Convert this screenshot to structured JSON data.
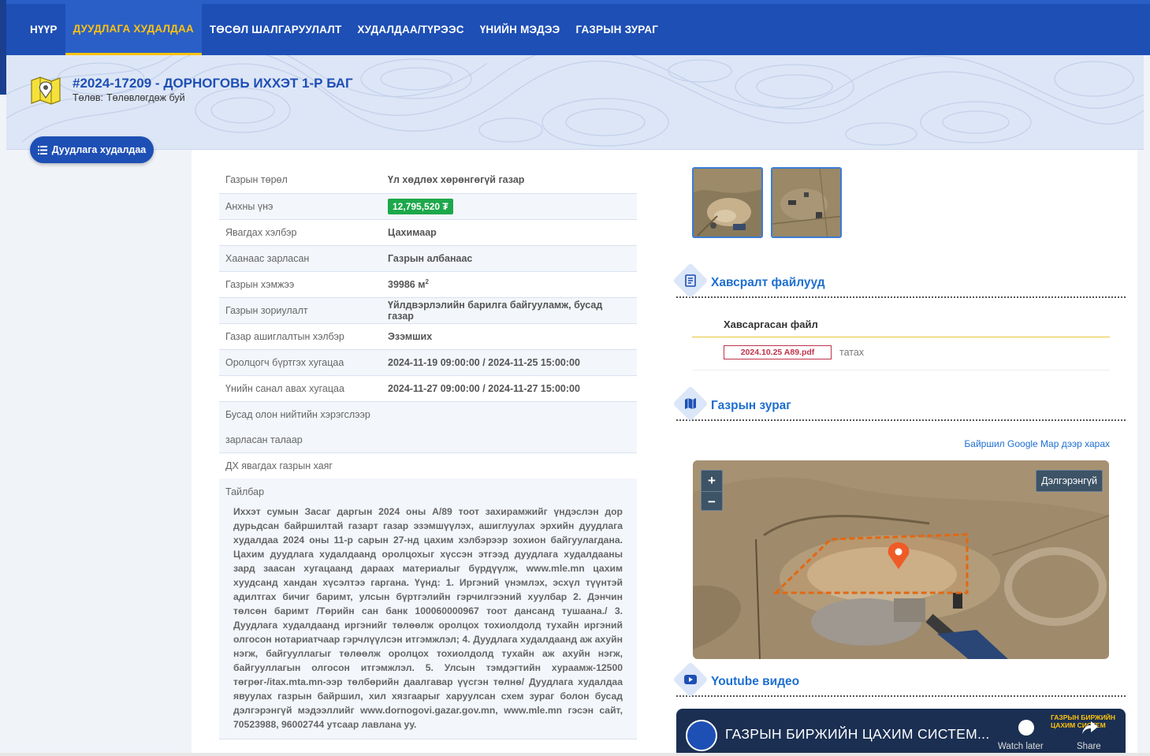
{
  "nav": {
    "items": [
      {
        "label": "НҮҮР",
        "active": false
      },
      {
        "label": "ДУУДЛАГА ХУДАЛДАА",
        "active": true
      },
      {
        "label": "ТӨСӨЛ ШАЛГАРУУЛАЛТ",
        "active": false
      },
      {
        "label": "ХУДАЛДАА/ТҮРЭЭС",
        "active": false
      },
      {
        "label": "ҮНИЙН МЭДЭЭ",
        "active": false
      },
      {
        "label": "ГАЗРЫН ЗУРАГ",
        "active": false
      }
    ]
  },
  "header": {
    "title": "#2024-17209 - ДОРНОГОВЬ ИХХЭТ 1-Р БАГ",
    "status_label": "Төлөв:",
    "status_value": "Төлөвлөгдөж буй"
  },
  "back_button": {
    "label": "Дуудлага худалдаа"
  },
  "details": [
    {
      "key": "Газрын төрөл",
      "value": "Үл хөдлөх хөрөнгөгүй газар"
    },
    {
      "key": "Анхны үнэ",
      "value": "12,795,520 ₮",
      "badge": true
    },
    {
      "key": "Явагдах хэлбэр",
      "value": "Цахимаар"
    },
    {
      "key": "Хаанаас зарласан",
      "value": "Газрын албанаас"
    },
    {
      "key": "Газрын хэмжээ",
      "value": "39986 м",
      "sup": "2"
    },
    {
      "key": "Газрын зориулалт",
      "value": "Үйлдвэрлэлийн барилга байгууламж, бусад газар"
    },
    {
      "key": "Газар ашиглалтын хэлбэр",
      "value": "Эзэмших"
    },
    {
      "key": "Оролцогч бүртгэх хугацаа",
      "value": "2024-11-19 09:00:00 / 2024-11-25 15:00:00"
    },
    {
      "key": "Үнийн санал авах хугацаа",
      "value": "2024-11-27 09:00:00 / 2024-11-27 15:00:00"
    },
    {
      "key_line1": "Бусад олон нийтийн хэрэгслээр",
      "key_line2": "зарласан талаар",
      "value": ""
    },
    {
      "key": "ДХ явагдах газрын хаяг",
      "value": ""
    }
  ],
  "description": {
    "label": "Тайлбар",
    "text": "Иххэт сумын Засаг даргын 2024 оны А/89 тоот захирамжийг үндэслэн дор дурьдсан байршилтай газарт газар эзэмшүүлэх, ашиглуулах эрхийн дуудлага худалдаа 2024 оны 11-р сарын 27-нд цахим хэлбэрээр зохион байгуулагдана. Цахим дуудлага худалдаанд оролцохыг хүссэн этгээд дуудлага худалдааны зард заасан хугацаанд дараах материалыг бүрдүүлж, www.mle.mn цахим хуудсанд хандан хүсэлтээ гаргана. Үүнд: 1. Иргэний үнэмлэх, эсхүл түүнтэй адилтгах бичиг баримт, улсын бүртгэлийн гэрчилгээний хуулбар 2. Дэнчин төлсөн баримт /Төрийн сан банк 100060000967 тоот дансанд тушаана./ 3. Дуудлага худалдаанд иргэнийг төлөөлж оролцох тохиолдолд тухайн иргэний олгосон нотариатчаар гэрчлүүлсэн итгэмжлэл; 4. Дуудлага худалдаанд аж ахуйн нэгж, байгууллагыг төлөөлж оролцох тохиолдолд тухайн аж ахуйн нэгж, байгууллагын олгосон итгэмжлэл. 5. Улсын тэмдэгтийн хураамж-12500 төгрөг-/itax.mta.mn-ээр төлбөрийн даалгавар үүсгэн төлнө/ Дуудлага худалдаа явуулах газрын байршил, хил хязгаарыг харуулсан схем зураг болон бусад дэлгэрэнгүй мэдээллийг www.dornogovi.gazar.gov.mn, www.mle.mn гэсэн сайт, 70523988, 96002744 утсаар лавлана уу."
  },
  "attachments": {
    "title": "Хавсралт файлууд",
    "header": "Хавсаргасан файл",
    "files": [
      {
        "name": "2024.10.25 A89.pdf",
        "action": "татах"
      }
    ]
  },
  "map_section": {
    "title": "Газрын зураг",
    "google_link": "Байршил Google Map дээр харах",
    "zoom_in": "+",
    "zoom_out": "−",
    "more_button": "Дэлгэрэнгүй"
  },
  "video_section": {
    "title": "Youtube видео",
    "video_title": "ГАЗРЫН БИРЖИЙН ЦАХИМ СИСТЕМ...",
    "watch_later": "Watch later",
    "share": "Share",
    "brand_text": "ГАЗРЫН БИРЖИЙН ЦАХИМ СИСТЕМ"
  },
  "colors": {
    "nav_bg": "#1e4fb5",
    "accent": "#ffc20e",
    "price_badge": "#1ca84a",
    "link": "#1e6fd0",
    "file_chip": "#c0334a"
  }
}
